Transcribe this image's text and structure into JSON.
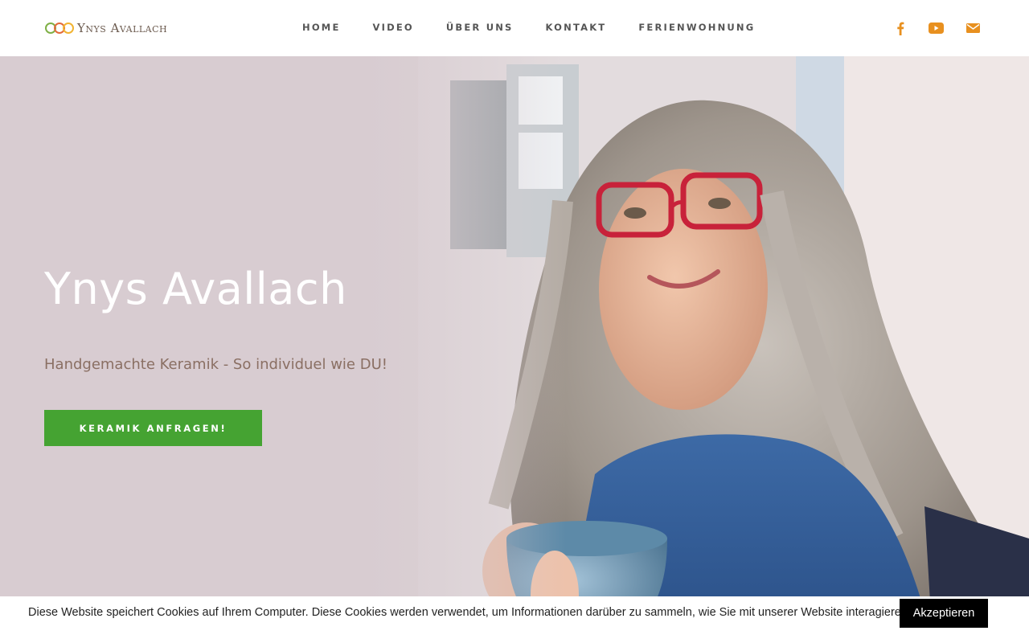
{
  "header": {
    "logo_text": "Ynys Avallach",
    "nav": [
      {
        "label": "HOME"
      },
      {
        "label": "VIDEO"
      },
      {
        "label": "ÜBER UNS"
      },
      {
        "label": "KONTAKT"
      },
      {
        "label": "FERIENWOHNUNG"
      }
    ],
    "social_icons": [
      "facebook-icon",
      "youtube-icon",
      "mail-icon"
    ],
    "accent_color": "#e8901f"
  },
  "hero": {
    "title": "Ynys Avallach",
    "subtitle": "Handgemachte Keramik - So individuel wie DU!",
    "cta_label": "KERAMIK ANFRAGEN!",
    "cta_color": "#45a332",
    "background_color": "#d8ccd1"
  },
  "cookie_bar": {
    "text": "Diese Website speichert Cookies auf Ihrem Computer. Diese Cookies werden verwendet, um Informationen darüber zu sammeln, wie Sie mit unserer Website interagieren.",
    "accept_label": "Akzeptieren"
  }
}
